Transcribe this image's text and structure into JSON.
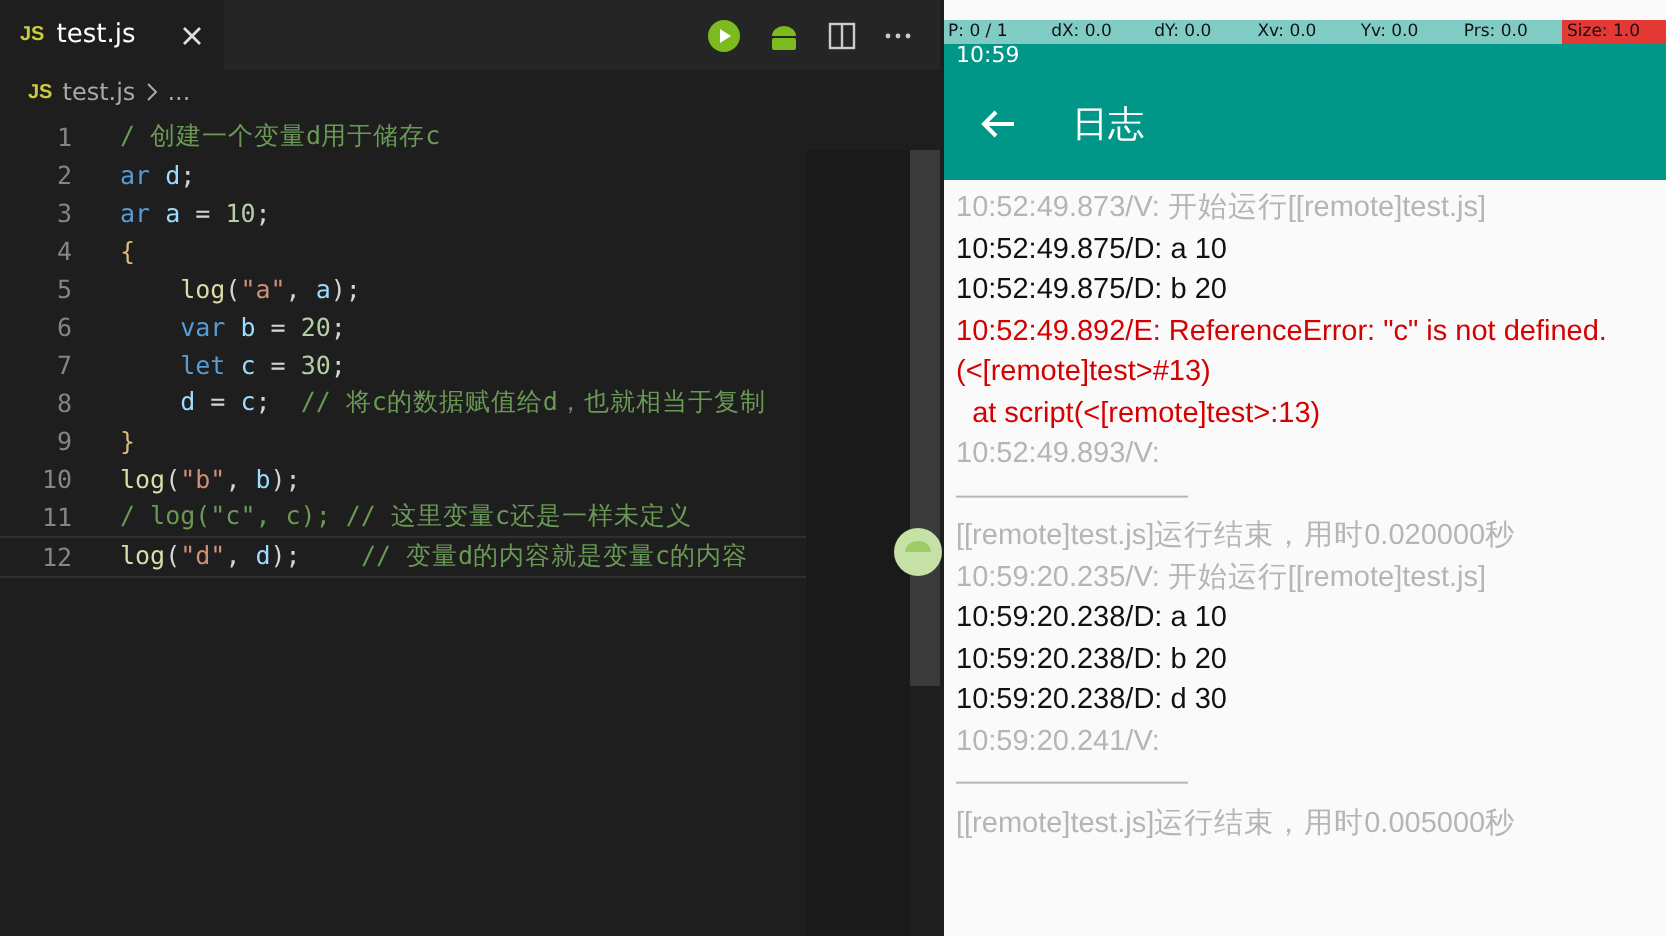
{
  "editor": {
    "tabs": [
      {
        "icon": "JS",
        "label": "test.js",
        "selected": true
      }
    ],
    "breadcrumb": {
      "icon": "JS",
      "file": "test.js",
      "rest": "..."
    },
    "lines": [
      {
        "number": "1",
        "tokens": [
          {
            "kind": "comment",
            "text": "/ 创建一个变量d用于储存c"
          }
        ]
      },
      {
        "number": "2",
        "tokens": [
          {
            "kind": "keyword",
            "text": "ar"
          },
          {
            "kind": "ident",
            "text": " d"
          },
          {
            "kind": "plain",
            "text": ";"
          }
        ]
      },
      {
        "number": "3",
        "tokens": [
          {
            "kind": "keyword",
            "text": "ar"
          },
          {
            "kind": "ident",
            "text": " a"
          },
          {
            "kind": "plain",
            "text": " = "
          },
          {
            "kind": "number",
            "text": "10"
          },
          {
            "kind": "plain",
            "text": ";"
          }
        ]
      },
      {
        "number": "4",
        "tokens": [
          {
            "kind": "brace",
            "text": "{"
          }
        ]
      },
      {
        "number": "5",
        "indented": true,
        "tokens": [
          {
            "kind": "func",
            "text": "log"
          },
          {
            "kind": "plain",
            "text": "("
          },
          {
            "kind": "string",
            "text": "\"a\""
          },
          {
            "kind": "plain",
            "text": ", "
          },
          {
            "kind": "ident",
            "text": "a"
          },
          {
            "kind": "plain",
            "text": ");"
          }
        ]
      },
      {
        "number": "6",
        "indented": true,
        "tokens": [
          {
            "kind": "keyword",
            "text": "var"
          },
          {
            "kind": "ident",
            "text": " b"
          },
          {
            "kind": "plain",
            "text": " = "
          },
          {
            "kind": "number",
            "text": "20"
          },
          {
            "kind": "plain",
            "text": ";"
          }
        ]
      },
      {
        "number": "7",
        "indented": true,
        "tokens": [
          {
            "kind": "keyword",
            "text": "let"
          },
          {
            "kind": "ident",
            "text": " c"
          },
          {
            "kind": "plain",
            "text": " = "
          },
          {
            "kind": "number",
            "text": "30"
          },
          {
            "kind": "plain",
            "text": ";"
          }
        ]
      },
      {
        "number": "8",
        "indented": true,
        "tokens": [
          {
            "kind": "ident",
            "text": "d"
          },
          {
            "kind": "plain",
            "text": " = "
          },
          {
            "kind": "ident",
            "text": "c"
          },
          {
            "kind": "plain",
            "text": ";  "
          },
          {
            "kind": "comment",
            "text": "// 将c的数据赋值给d，也就相当于复制"
          }
        ]
      },
      {
        "number": "9",
        "tokens": [
          {
            "kind": "brace",
            "text": "}"
          }
        ]
      },
      {
        "number": "10",
        "tokens": [
          {
            "kind": "func",
            "text": "log"
          },
          {
            "kind": "plain",
            "text": "("
          },
          {
            "kind": "string",
            "text": "\"b\""
          },
          {
            "kind": "plain",
            "text": ", "
          },
          {
            "kind": "ident",
            "text": "b"
          },
          {
            "kind": "plain",
            "text": ");"
          }
        ]
      },
      {
        "number": "11",
        "tokens": [
          {
            "kind": "comment",
            "text": "/ log(\"c\", c); // 这里变量c还是一样未定义"
          }
        ]
      },
      {
        "number": "12",
        "tokens": [
          {
            "kind": "func",
            "text": "log"
          },
          {
            "kind": "plain",
            "text": "("
          },
          {
            "kind": "string",
            "text": "\"d\""
          },
          {
            "kind": "plain",
            "text": ", "
          },
          {
            "kind": "ident",
            "text": "d"
          },
          {
            "kind": "plain",
            "text": ");    "
          },
          {
            "kind": "comment",
            "text": "// 变量d的内容就是变量c的内容"
          }
        ]
      }
    ]
  },
  "phone": {
    "pointer_info": [
      {
        "text": "P: 0 / 1",
        "kind": "normal"
      },
      {
        "text": "dX: 0.0",
        "kind": "normal"
      },
      {
        "text": "dY: 0.0",
        "kind": "normal"
      },
      {
        "text": "Xv: 0.0",
        "kind": "normal"
      },
      {
        "text": "Yv: 0.0",
        "kind": "normal"
      },
      {
        "text": "Prs: 0.0",
        "kind": "normal"
      },
      {
        "text": "Size: 1.0",
        "kind": "alert"
      }
    ],
    "status_time": "10:59",
    "title": "日志",
    "log": [
      {
        "kind": "verbose",
        "text": "10:52:49.873/V: 开始运行[[remote]test.js]"
      },
      {
        "kind": "debug",
        "text": "10:52:49.875/D: a 10"
      },
      {
        "kind": "debug",
        "text": "10:52:49.875/D: b 20"
      },
      {
        "kind": "error",
        "text": "10:52:49.892/E: ReferenceError: \"c\" is not defined. (<[remote]test>#13)\n  at script(<[remote]test>:13)"
      },
      {
        "kind": "verbose",
        "text": "10:52:49.893/V:"
      },
      {
        "kind": "verbose",
        "text": "————————"
      },
      {
        "kind": "verbose",
        "text": "[[remote]test.js]运行结束，用时0.020000秒"
      },
      {
        "kind": "verbose",
        "text": "10:59:20.235/V: 开始运行[[remote]test.js]"
      },
      {
        "kind": "debug",
        "text": "10:59:20.238/D: a 10"
      },
      {
        "kind": "debug",
        "text": "10:59:20.238/D: b 20"
      },
      {
        "kind": "debug",
        "text": "10:59:20.238/D: d 30"
      },
      {
        "kind": "verbose",
        "text": "10:59:20.241/V:"
      },
      {
        "kind": "verbose",
        "text": "————————"
      },
      {
        "kind": "verbose",
        "text": "[[remote]test.js]运行结束，用时0.005000秒"
      }
    ]
  }
}
